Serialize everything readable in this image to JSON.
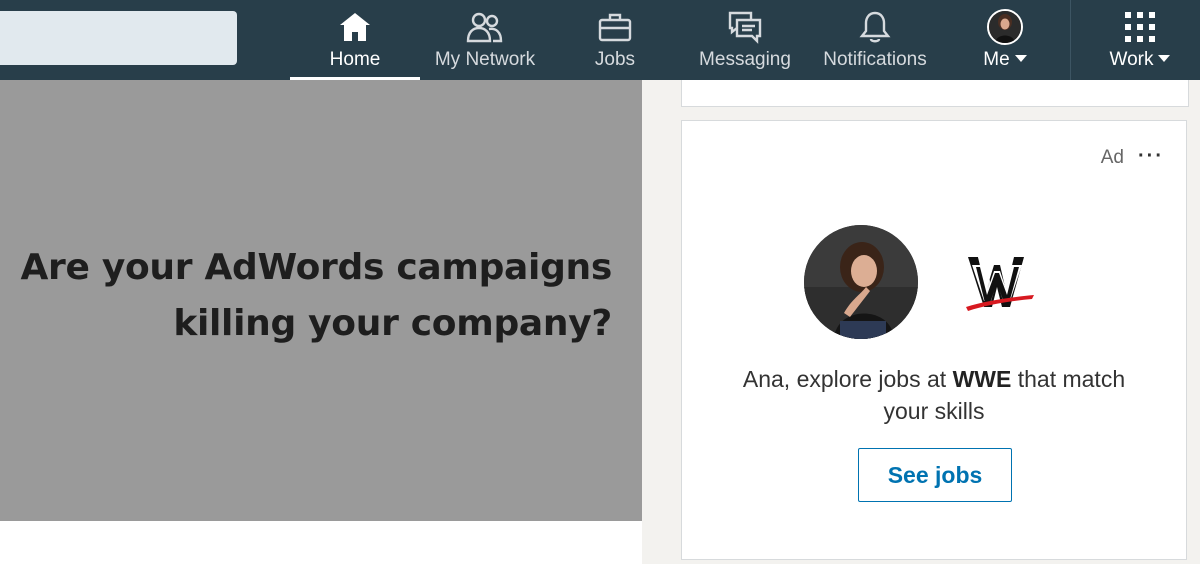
{
  "nav": {
    "items": [
      {
        "label": "Home",
        "icon": "home-icon"
      },
      {
        "label": "My Network",
        "icon": "network-icon"
      },
      {
        "label": "Jobs",
        "icon": "briefcase-icon"
      },
      {
        "label": "Messaging",
        "icon": "messaging-icon"
      },
      {
        "label": "Notifications",
        "icon": "bell-icon"
      },
      {
        "label": "Me",
        "icon": "avatar"
      },
      {
        "label": "Work",
        "icon": "grid-icon"
      }
    ],
    "active": "Home"
  },
  "ad_image": {
    "line1": "Are your AdWords campaigns",
    "line2": "killing your company?"
  },
  "ad_card": {
    "ad_label": "Ad",
    "more_label": "···",
    "message_prefix": "Ana, explore jobs at ",
    "company": "WWE",
    "message_suffix": " that match your skills",
    "button_label": "See jobs"
  },
  "colors": {
    "nav_bg": "#283e4a",
    "accent": "#0073b1",
    "logo_red": "#d71920"
  }
}
